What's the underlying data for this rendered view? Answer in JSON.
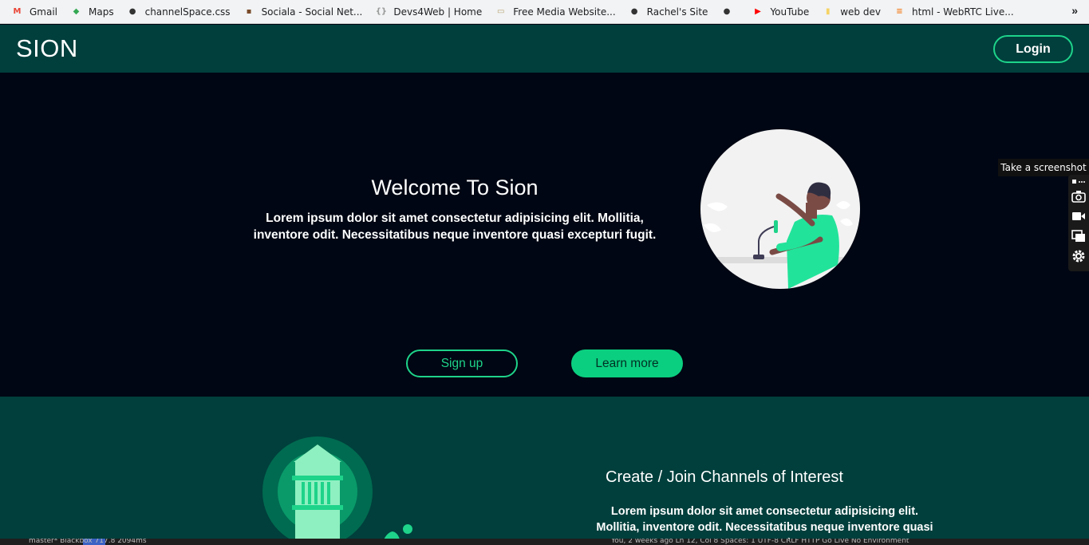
{
  "bookmarks": [
    {
      "label": "Gmail",
      "icon": "gmail-icon",
      "color": "#ea4335"
    },
    {
      "label": "Maps",
      "icon": "maps-icon",
      "color": "#34a853"
    },
    {
      "label": "channelSpace.css",
      "icon": "globe-icon",
      "color": "#333333"
    },
    {
      "label": "Sociala - Social Net...",
      "icon": "sociala-icon",
      "color": "#7a4b2a"
    },
    {
      "label": "Devs4Web | Home",
      "icon": "devs4web-icon",
      "color": "#999999"
    },
    {
      "label": "Free Media Website...",
      "icon": "media-icon",
      "color": "#b8a070"
    },
    {
      "label": "Rachel's Site",
      "icon": "globe-icon",
      "color": "#333333"
    },
    {
      "label": "",
      "icon": "globe-icon",
      "color": "#333333"
    },
    {
      "label": "YouTube",
      "icon": "youtube-icon",
      "color": "#ff0000"
    },
    {
      "label": "web dev",
      "icon": "folder-icon",
      "color": "#f6d365"
    },
    {
      "label": "html - WebRTC Live...",
      "icon": "stackoverflow-icon",
      "color": "#f48024"
    }
  ],
  "bookmarks_more": "»",
  "header": {
    "logo": "SION",
    "login": "Login"
  },
  "hero": {
    "title": "Welcome To Sion",
    "text": "Lorem ipsum dolor sit amet consectetur adipisicing elit. Mollitia, inventore odit. Necessitatibus neque inventore quasi excepturi fugit.",
    "signup": "Sign up",
    "learn_more": "Learn more"
  },
  "section2": {
    "title": "Create / Join Channels of Interest",
    "text": "Lorem ipsum dolor sit amet consectetur adipisicing elit. Mollitia, inventore odit. Necessitatibus neque inventore quasi excepturi"
  },
  "screenshot_tool": {
    "tooltip": "Take a screenshot"
  },
  "statusbar": {
    "left": "master*   Blackbox   717.8   2094ms",
    "right": "You, 2 weeks ago   Ln 12, Col 8   Spaces: 1   UTF-8   CRLF   HTTP   Go Live   No Environment"
  },
  "colors": {
    "accent": "#1ed38a",
    "header_bg": "#003f3c",
    "hero_bg": "#000613"
  }
}
